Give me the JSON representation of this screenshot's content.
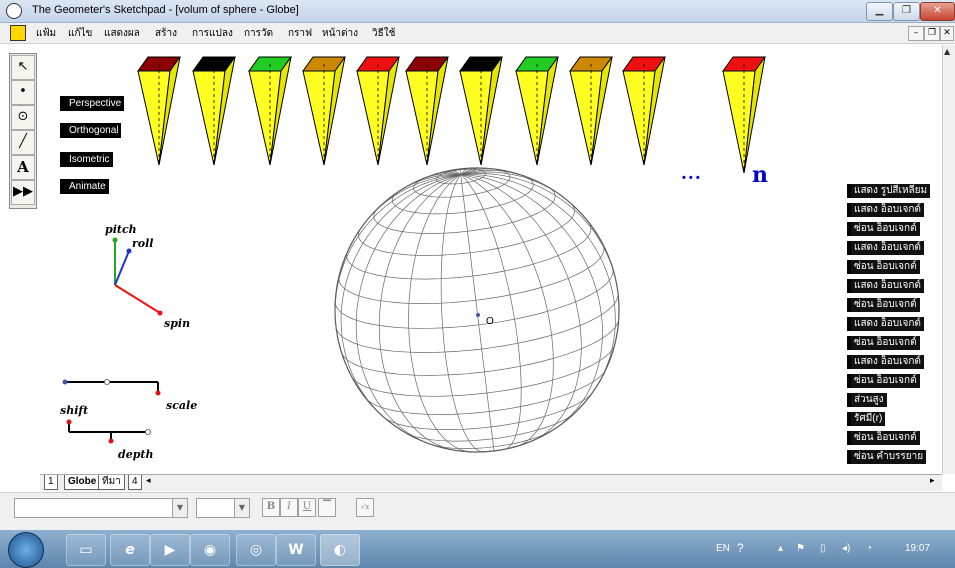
{
  "window": {
    "title": "The Geometer's Sketchpad - [volum of sphere - Globe]",
    "buttons": [
      "minimize",
      "restore",
      "close"
    ]
  },
  "menu": {
    "items": [
      "แฟ้ม",
      "แก้ไข",
      "แสดงผล",
      "สร้าง",
      "การแปลง",
      "การวัด",
      "กราฟ",
      "หน้าต่าง",
      "วิธีใช้"
    ]
  },
  "toolbox": {
    "tools": [
      "arrow-icon",
      "point-icon",
      "compass-icon",
      "straightedge-icon",
      "text-icon",
      "custom-tool-icon"
    ],
    "text_tool_label": "A"
  },
  "canvas": {
    "left_buttons": [
      "Perspective",
      "Orthogonal",
      "Isometric",
      "Animate"
    ],
    "labels": {
      "pitch": "pitch",
      "roll": "roll",
      "spin": "spin",
      "scale": "scale",
      "shift": "shift",
      "depth": "depth",
      "center": "O",
      "dots": "• • •",
      "n": "n"
    },
    "wedge_top_colors": [
      "#8b0000",
      "#000000",
      "#22cc22",
      "#cc8800",
      "#ee1111",
      "#8b0000",
      "#000000",
      "#22cc22",
      "#cc8800",
      "#ee1111",
      "#ee1111"
    ],
    "right_buttons": [
      "แสดง รูปสี่เหลี่ยม",
      "แสดง อ็อบเจกต์",
      "ซ่อน อ็อบเจกต์",
      "แสดง อ็อบเจกต์",
      "ซ่อน อ็อบเจกต์",
      "แสดง อ็อบเจกต์",
      "ซ่อน อ็อบเจกต์",
      "แสดง อ็อบเจกต์",
      "ซ่อน อ็อบเจกต์",
      "แสดง อ็อบเจกต์",
      "ซ่อน อ็อบเจกต์",
      "ส่วนสูง",
      "รัศมี(r)",
      "ซ่อน อ็อบเจกต์",
      "ซ่อน คำบรรยาย"
    ]
  },
  "tabs": {
    "items": [
      "1",
      "Globe",
      "ทีมา",
      "4"
    ]
  },
  "text_toolbar": {
    "bold": "B",
    "italic": "I",
    "underline": "U"
  },
  "taskbar": {
    "apps": [
      "windows-start-icon",
      "file-explorer-icon",
      "internet-explorer-icon",
      "media-player-icon",
      "paint-icon",
      "chrome-icon",
      "word-icon",
      "sketchpad-icon"
    ],
    "lang": "EN",
    "clock": "19:07"
  },
  "colors": {
    "wedge_body": "#ffff22",
    "axis_pitch": "#22aa22",
    "axis_roll": "#2233cc",
    "axis_spin": "#ee1111",
    "label_blue": "#0000cc"
  }
}
